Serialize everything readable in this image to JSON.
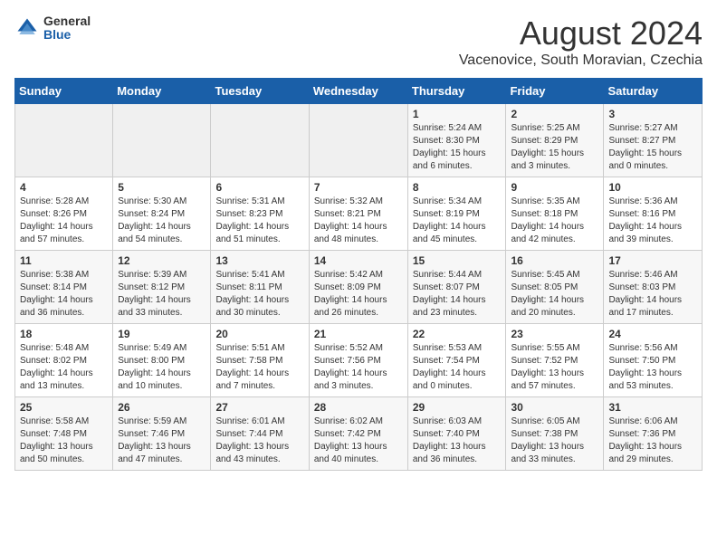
{
  "logo": {
    "general": "General",
    "blue": "Blue"
  },
  "title": {
    "month_year": "August 2024",
    "location": "Vacenovice, South Moravian, Czechia"
  },
  "weekdays": [
    "Sunday",
    "Monday",
    "Tuesday",
    "Wednesday",
    "Thursday",
    "Friday",
    "Saturday"
  ],
  "weeks": [
    [
      {
        "day": "",
        "info": ""
      },
      {
        "day": "",
        "info": ""
      },
      {
        "day": "",
        "info": ""
      },
      {
        "day": "",
        "info": ""
      },
      {
        "day": "1",
        "info": "Sunrise: 5:24 AM\nSunset: 8:30 PM\nDaylight: 15 hours\nand 6 minutes."
      },
      {
        "day": "2",
        "info": "Sunrise: 5:25 AM\nSunset: 8:29 PM\nDaylight: 15 hours\nand 3 minutes."
      },
      {
        "day": "3",
        "info": "Sunrise: 5:27 AM\nSunset: 8:27 PM\nDaylight: 15 hours\nand 0 minutes."
      }
    ],
    [
      {
        "day": "4",
        "info": "Sunrise: 5:28 AM\nSunset: 8:26 PM\nDaylight: 14 hours\nand 57 minutes."
      },
      {
        "day": "5",
        "info": "Sunrise: 5:30 AM\nSunset: 8:24 PM\nDaylight: 14 hours\nand 54 minutes."
      },
      {
        "day": "6",
        "info": "Sunrise: 5:31 AM\nSunset: 8:23 PM\nDaylight: 14 hours\nand 51 minutes."
      },
      {
        "day": "7",
        "info": "Sunrise: 5:32 AM\nSunset: 8:21 PM\nDaylight: 14 hours\nand 48 minutes."
      },
      {
        "day": "8",
        "info": "Sunrise: 5:34 AM\nSunset: 8:19 PM\nDaylight: 14 hours\nand 45 minutes."
      },
      {
        "day": "9",
        "info": "Sunrise: 5:35 AM\nSunset: 8:18 PM\nDaylight: 14 hours\nand 42 minutes."
      },
      {
        "day": "10",
        "info": "Sunrise: 5:36 AM\nSunset: 8:16 PM\nDaylight: 14 hours\nand 39 minutes."
      }
    ],
    [
      {
        "day": "11",
        "info": "Sunrise: 5:38 AM\nSunset: 8:14 PM\nDaylight: 14 hours\nand 36 minutes."
      },
      {
        "day": "12",
        "info": "Sunrise: 5:39 AM\nSunset: 8:12 PM\nDaylight: 14 hours\nand 33 minutes."
      },
      {
        "day": "13",
        "info": "Sunrise: 5:41 AM\nSunset: 8:11 PM\nDaylight: 14 hours\nand 30 minutes."
      },
      {
        "day": "14",
        "info": "Sunrise: 5:42 AM\nSunset: 8:09 PM\nDaylight: 14 hours\nand 26 minutes."
      },
      {
        "day": "15",
        "info": "Sunrise: 5:44 AM\nSunset: 8:07 PM\nDaylight: 14 hours\nand 23 minutes."
      },
      {
        "day": "16",
        "info": "Sunrise: 5:45 AM\nSunset: 8:05 PM\nDaylight: 14 hours\nand 20 minutes."
      },
      {
        "day": "17",
        "info": "Sunrise: 5:46 AM\nSunset: 8:03 PM\nDaylight: 14 hours\nand 17 minutes."
      }
    ],
    [
      {
        "day": "18",
        "info": "Sunrise: 5:48 AM\nSunset: 8:02 PM\nDaylight: 14 hours\nand 13 minutes."
      },
      {
        "day": "19",
        "info": "Sunrise: 5:49 AM\nSunset: 8:00 PM\nDaylight: 14 hours\nand 10 minutes."
      },
      {
        "day": "20",
        "info": "Sunrise: 5:51 AM\nSunset: 7:58 PM\nDaylight: 14 hours\nand 7 minutes."
      },
      {
        "day": "21",
        "info": "Sunrise: 5:52 AM\nSunset: 7:56 PM\nDaylight: 14 hours\nand 3 minutes."
      },
      {
        "day": "22",
        "info": "Sunrise: 5:53 AM\nSunset: 7:54 PM\nDaylight: 14 hours\nand 0 minutes."
      },
      {
        "day": "23",
        "info": "Sunrise: 5:55 AM\nSunset: 7:52 PM\nDaylight: 13 hours\nand 57 minutes."
      },
      {
        "day": "24",
        "info": "Sunrise: 5:56 AM\nSunset: 7:50 PM\nDaylight: 13 hours\nand 53 minutes."
      }
    ],
    [
      {
        "day": "25",
        "info": "Sunrise: 5:58 AM\nSunset: 7:48 PM\nDaylight: 13 hours\nand 50 minutes."
      },
      {
        "day": "26",
        "info": "Sunrise: 5:59 AM\nSunset: 7:46 PM\nDaylight: 13 hours\nand 47 minutes."
      },
      {
        "day": "27",
        "info": "Sunrise: 6:01 AM\nSunset: 7:44 PM\nDaylight: 13 hours\nand 43 minutes."
      },
      {
        "day": "28",
        "info": "Sunrise: 6:02 AM\nSunset: 7:42 PM\nDaylight: 13 hours\nand 40 minutes."
      },
      {
        "day": "29",
        "info": "Sunrise: 6:03 AM\nSunset: 7:40 PM\nDaylight: 13 hours\nand 36 minutes."
      },
      {
        "day": "30",
        "info": "Sunrise: 6:05 AM\nSunset: 7:38 PM\nDaylight: 13 hours\nand 33 minutes."
      },
      {
        "day": "31",
        "info": "Sunrise: 6:06 AM\nSunset: 7:36 PM\nDaylight: 13 hours\nand 29 minutes."
      }
    ]
  ]
}
